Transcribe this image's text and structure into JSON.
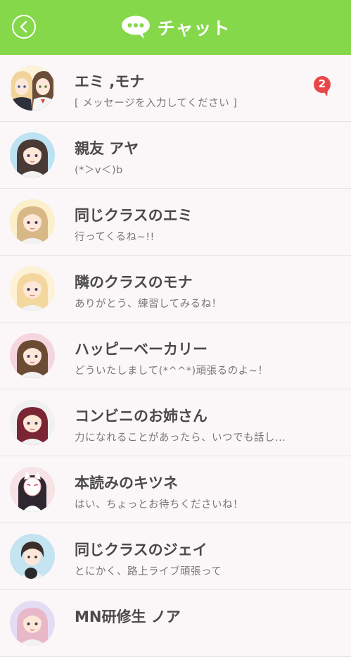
{
  "header": {
    "title": "チャット",
    "color": "#86d84b"
  },
  "chats": [
    {
      "name": "エミ ,モナ",
      "message": "[ メッセージを入力してください ]",
      "badge": "2",
      "avatar": "group-avatar",
      "hair": "#f1d49a",
      "hair2": "#6b4e3a",
      "bg": "#fdf3da"
    },
    {
      "name": "親友 アヤ",
      "message": "(*＞v＜)b",
      "badge": "",
      "avatar": "girl-avatar",
      "hair": "#4a3a36",
      "bg": "#bde3f2"
    },
    {
      "name": "同じクラスのエミ",
      "message": "行ってくるね~!!",
      "badge": "",
      "avatar": "girl-avatar",
      "hair": "#d9b887",
      "bg": "#fbf0c9"
    },
    {
      "name": "隣のクラスのモナ",
      "message": "ありがとう、練習してみるね！",
      "badge": "",
      "avatar": "girl-avatar",
      "hair": "#f3d79f",
      "bg": "#fdf1d6"
    },
    {
      "name": "ハッピーベーカリー",
      "message": "どういたしまして(*^^*)頑張るのよ~！",
      "badge": "",
      "avatar": "girl-avatar",
      "hair": "#6b4b33",
      "bg": "#f6d6de"
    },
    {
      "name": "コンビニのお姉さん",
      "message": "力になれることがあったら、いつでも話し...",
      "badge": "",
      "avatar": "girl-avatar",
      "hair": "#7a2534",
      "bg": "#f1f1f1"
    },
    {
      "name": "本読みのキツネ",
      "message": "はい、ちょっとお待ちくださいね！",
      "badge": "",
      "avatar": "fox-avatar",
      "hair": "#2e2730",
      "bg": "#f7e3e6"
    },
    {
      "name": "同じクラスのジェイ",
      "message": "とにかく、路上ライブ頑張って",
      "badge": "",
      "avatar": "boy-avatar",
      "hair": "#3a2d2a",
      "bg": "#c5e4f1"
    },
    {
      "name": "MN研修生 ノア",
      "message": "",
      "badge": "",
      "avatar": "girl-avatar",
      "hair": "#e8b8c8",
      "bg": "#e3ddf4"
    }
  ]
}
